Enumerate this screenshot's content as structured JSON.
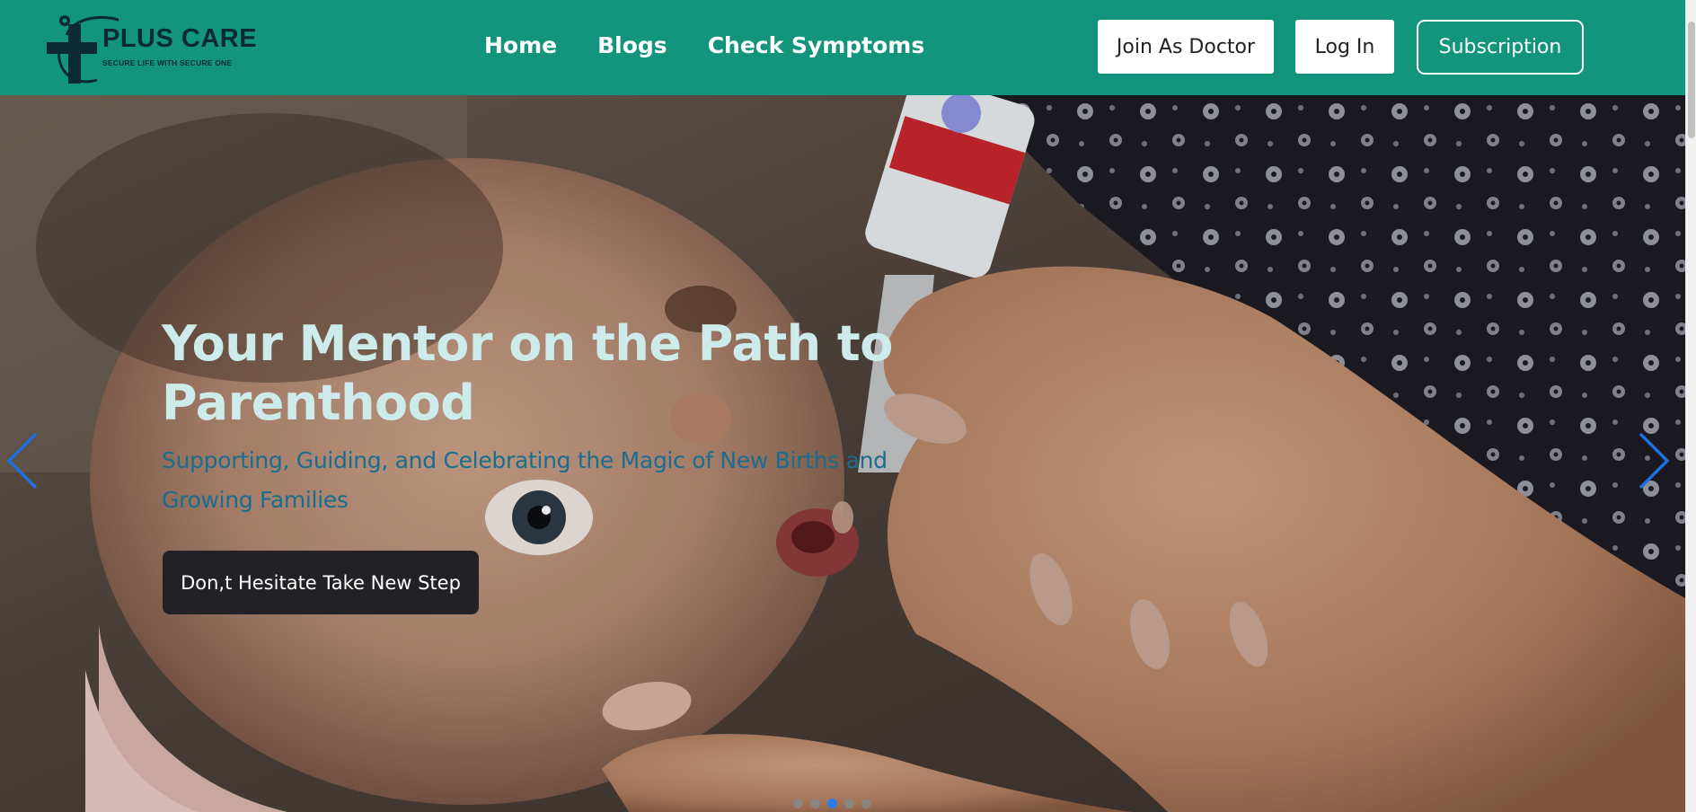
{
  "brand": {
    "name": "PLUS CARE",
    "tagline": "SECURE LIFE WITH SECURE ONE",
    "logo_icon": "medical-cross-logo"
  },
  "nav": {
    "links": [
      {
        "label": "Home"
      },
      {
        "label": "Blogs"
      },
      {
        "label": "Check Symptoms"
      }
    ]
  },
  "actions": {
    "join_doctor": "Join As Doctor",
    "login": "Log In",
    "subscription": "Subscription"
  },
  "hero": {
    "title": "Your Mentor on the Path to Parenthood",
    "subtitle": "Supporting, Guiding, and Celebrating the Magic of New Births and Growing Families",
    "cta": "Don,t Hesitate Take New Step",
    "prev_icon": "chevron-left-icon",
    "next_icon": "chevron-right-icon",
    "slides_count": 5,
    "active_slide": 2
  },
  "colors": {
    "header_bg": "#12957c",
    "title": "#cdebea",
    "subtitle": "#1a6d8c",
    "cta_bg": "#222226",
    "arrow": "#1f6fe0",
    "indicator_active": "#2c7de8"
  }
}
